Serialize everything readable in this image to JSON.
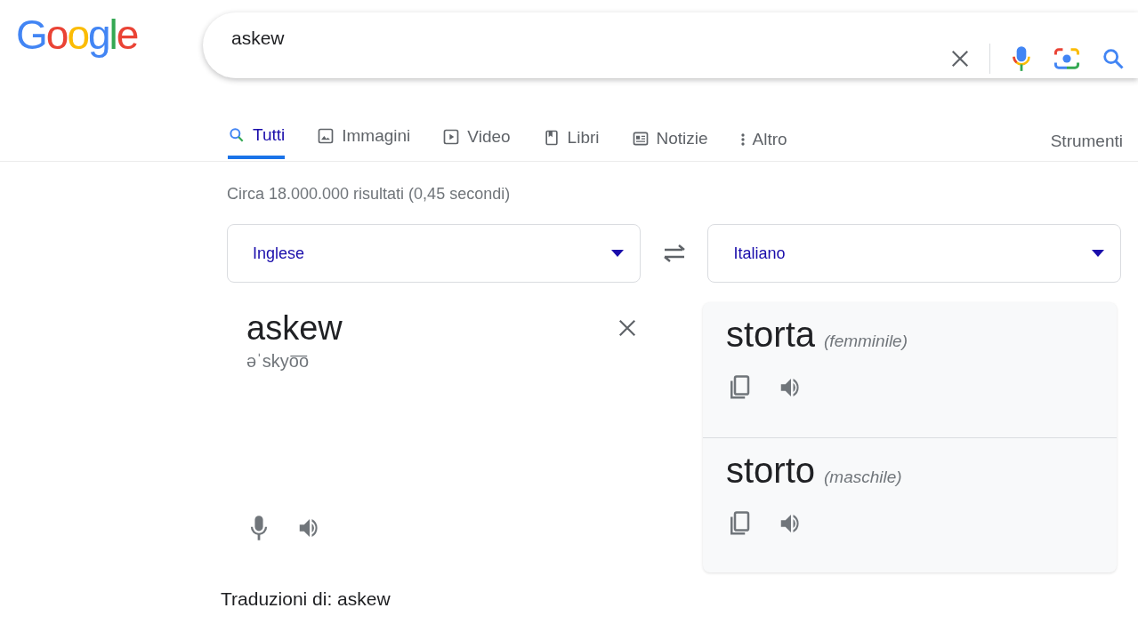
{
  "logo": {
    "text": "Google"
  },
  "search": {
    "value": "askew"
  },
  "tabs": [
    {
      "label": "Tutti",
      "kind": "search",
      "selected": true
    },
    {
      "label": "Immagini",
      "kind": "image",
      "selected": false
    },
    {
      "label": "Video",
      "kind": "video",
      "selected": false
    },
    {
      "label": "Libri",
      "kind": "book",
      "selected": false
    },
    {
      "label": "Notizie",
      "kind": "news",
      "selected": false
    },
    {
      "label": "Altro",
      "kind": "more",
      "selected": false
    }
  ],
  "tools": "Strumenti",
  "result_stats": "Circa 18.000.000 risultati (0,45 secondi)",
  "translator": {
    "source_language": "Inglese",
    "target_language": "Italiano",
    "source_text": "askew",
    "pronunciation": "əˈskyo͞o",
    "translations": [
      {
        "word": "storta",
        "gender": "(femminile)"
      },
      {
        "word": "storto",
        "gender": "(maschile)"
      }
    ]
  },
  "footer": "Traduzioni di: askew"
}
